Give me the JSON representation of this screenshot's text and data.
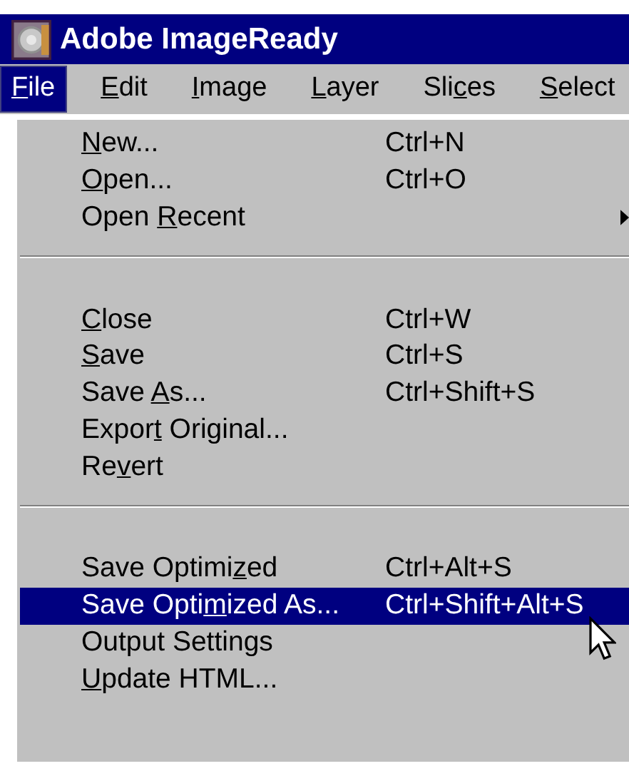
{
  "window": {
    "title": "Adobe ImageReady"
  },
  "menubar": [
    {
      "label": [
        {
          "text": "F",
          "underline": true
        },
        {
          "text": "ile",
          "underline": false
        }
      ],
      "selected": true
    },
    {
      "label": [
        {
          "text": "E",
          "underline": true
        },
        {
          "text": "dit",
          "underline": false
        }
      ],
      "selected": false
    },
    {
      "label": [
        {
          "text": "I",
          "underline": true
        },
        {
          "text": "mage",
          "underline": false
        }
      ],
      "selected": false
    },
    {
      "label": [
        {
          "text": "L",
          "underline": true
        },
        {
          "text": "ayer",
          "underline": false
        }
      ],
      "selected": false
    },
    {
      "label": [
        {
          "text": "Sli",
          "underline": false
        },
        {
          "text": "c",
          "underline": true
        },
        {
          "text": "es",
          "underline": false
        }
      ],
      "selected": false
    },
    {
      "label": [
        {
          "text": "S",
          "underline": true
        },
        {
          "text": "elect",
          "underline": false
        }
      ],
      "selected": false
    }
  ],
  "menu": [
    {
      "kind": "item",
      "label": [
        {
          "text": "N",
          "underline": true
        },
        {
          "text": "ew...",
          "underline": false
        }
      ],
      "shortcut": "Ctrl+N",
      "submenu": false,
      "selected": false
    },
    {
      "kind": "item",
      "label": [
        {
          "text": "O",
          "underline": true
        },
        {
          "text": "pen...",
          "underline": false
        }
      ],
      "shortcut": "Ctrl+O",
      "submenu": false,
      "selected": false
    },
    {
      "kind": "item",
      "label": [
        {
          "text": "Open ",
          "underline": false
        },
        {
          "text": "R",
          "underline": true
        },
        {
          "text": "ecent",
          "underline": false
        }
      ],
      "submenu": true,
      "selected": false
    },
    {
      "kind": "separator"
    },
    {
      "kind": "item",
      "label": [
        {
          "text": "C",
          "underline": true
        },
        {
          "text": "lose",
          "underline": false
        }
      ],
      "shortcut": "Ctrl+W",
      "submenu": false,
      "selected": false
    },
    {
      "kind": "item",
      "label": [
        {
          "text": "S",
          "underline": true
        },
        {
          "text": "ave",
          "underline": false
        }
      ],
      "shortcut": "Ctrl+S",
      "submenu": false,
      "selected": false
    },
    {
      "kind": "item",
      "label": [
        {
          "text": "Save ",
          "underline": false
        },
        {
          "text": "A",
          "underline": true
        },
        {
          "text": "s...",
          "underline": false
        }
      ],
      "shortcut": "Ctrl+Shift+S",
      "submenu": false,
      "selected": false
    },
    {
      "kind": "item",
      "label": [
        {
          "text": "Expor",
          "underline": false
        },
        {
          "text": "t",
          "underline": true
        },
        {
          "text": " Original...",
          "underline": false
        }
      ],
      "submenu": false,
      "selected": false
    },
    {
      "kind": "item",
      "label": [
        {
          "text": "Re",
          "underline": false
        },
        {
          "text": "v",
          "underline": true
        },
        {
          "text": "ert",
          "underline": false
        }
      ],
      "submenu": false,
      "selected": false
    },
    {
      "kind": "separator"
    },
    {
      "kind": "item",
      "label": [
        {
          "text": "Save Optimi",
          "underline": false
        },
        {
          "text": "z",
          "underline": true
        },
        {
          "text": "ed",
          "underline": false
        }
      ],
      "shortcut": "Ctrl+Alt+S",
      "submenu": false,
      "selected": false
    },
    {
      "kind": "item",
      "label": [
        {
          "text": "Save Opti",
          "underline": false
        },
        {
          "text": "m",
          "underline": true
        },
        {
          "text": "ized As...",
          "underline": false
        }
      ],
      "shortcut": "Ctrl+Shift+Alt+S",
      "submenu": false,
      "selected": true
    },
    {
      "kind": "item",
      "label": [
        {
          "text": "Output Settings",
          "underline": false
        }
      ],
      "submenu": false,
      "selected": false
    },
    {
      "kind": "item",
      "label": [
        {
          "text": "U",
          "underline": true
        },
        {
          "text": "pdate HTML...",
          "underline": false
        }
      ],
      "submenu": false,
      "selected": false
    }
  ]
}
